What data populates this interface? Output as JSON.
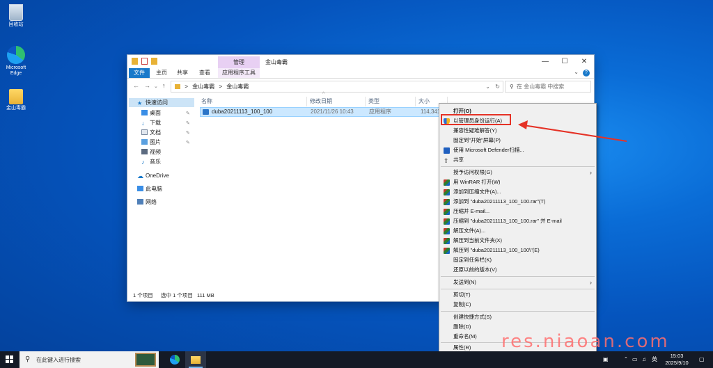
{
  "desktop": {
    "icons": [
      {
        "label": "回收站"
      },
      {
        "label": "Microsoft Edge"
      },
      {
        "label": "金山毒霸"
      }
    ]
  },
  "window": {
    "title": "金山毒霸",
    "manage_tab": "管理",
    "controls": {
      "minimize": "—",
      "maximize": "☐",
      "close": "✕"
    },
    "ribbon_tabs": [
      "文件",
      "主页",
      "共享",
      "查看",
      "应用程序工具"
    ],
    "address": {
      "segments": [
        "金山毒霸",
        "金山毒霸"
      ],
      "sep": ">"
    },
    "search_placeholder": "在 金山毒霸 中搜索",
    "sidebar": [
      {
        "label": "快速访问"
      },
      {
        "label": "桌面"
      },
      {
        "label": "下载"
      },
      {
        "label": "文档"
      },
      {
        "label": "图片"
      },
      {
        "label": "视频"
      },
      {
        "label": "音乐"
      },
      {
        "label": "OneDrive"
      },
      {
        "label": "此电脑"
      },
      {
        "label": "网络"
      }
    ],
    "columns": [
      "名称",
      "修改日期",
      "类型",
      "大小"
    ],
    "file": {
      "name": "duba20211113_100_100",
      "date": "2021/11/26 10:43",
      "type": "应用程序",
      "size": "114,341"
    },
    "status": {
      "count": "1 个项目",
      "selected": "选中 1 个项目",
      "size": "111 MB"
    }
  },
  "context_menu": {
    "items": [
      {
        "label": "打开(O)"
      },
      {
        "label": "以管理员身份运行(A)"
      },
      {
        "label": "兼容性疑难解答(Y)"
      },
      {
        "label": "固定到\"开始\"屏幕(P)"
      },
      {
        "label": "使用 Microsoft Defender扫描..."
      },
      {
        "label": "共享"
      },
      {
        "label": "授予访问权限(G)"
      },
      {
        "label": "用 WinRAR 打开(W)"
      },
      {
        "label": "添加到压缩文件(A)..."
      },
      {
        "label": "添加到 \"duba20211113_100_100.rar\"(T)"
      },
      {
        "label": "压缩并 E-mail..."
      },
      {
        "label": "压缩到 \"duba20211113_100_100.rar\" 并 E-mail"
      },
      {
        "label": "解压文件(A)..."
      },
      {
        "label": "解压到当前文件夹(X)"
      },
      {
        "label": "解压到 \"duba20211113_100_100\\\"(E)"
      },
      {
        "label": "固定到任务栏(K)"
      },
      {
        "label": "还原以前的版本(V)"
      },
      {
        "label": "发送到(N)"
      },
      {
        "label": "剪切(T)"
      },
      {
        "label": "复制(C)"
      },
      {
        "label": "创建快捷方式(S)"
      },
      {
        "label": "删除(D)"
      },
      {
        "label": "重命名(M)"
      },
      {
        "label": "属性(R)"
      }
    ]
  },
  "watermark": "res.niaoan.com",
  "taskbar": {
    "search_text": "在此键入进行搜索",
    "ime": "英",
    "time": "15:03",
    "date": "2025/9/10"
  },
  "colors": {
    "accent": "#1979ca",
    "highlight_border": "#e53226",
    "arrow": "#e53226"
  }
}
